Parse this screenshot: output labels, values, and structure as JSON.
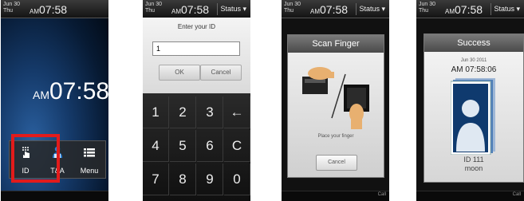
{
  "statusbar": {
    "date_line1": "Jun  30",
    "date_line2": "Thu",
    "ampm": "AM",
    "time": "07:58",
    "status_label": "Status ▾"
  },
  "bottom_bar": {
    "label": "Call"
  },
  "screen1": {
    "clock_ampm": "AM",
    "clock_time": "07:58",
    "buttons": [
      {
        "label": "ID",
        "icon": "hand-tap-icon"
      },
      {
        "label": "T&A",
        "icon": "user-icon"
      },
      {
        "label": "Menu",
        "icon": "list-menu-icon"
      }
    ],
    "highlight_color": "#e21b1b"
  },
  "screen2": {
    "title": "Enter your ID",
    "input_value": "1",
    "ok_label": "OK",
    "cancel_label": "Cancel",
    "keys": [
      "1",
      "2",
      "3",
      "←",
      "4",
      "5",
      "6",
      "C",
      "7",
      "8",
      "9",
      "0"
    ]
  },
  "screen3": {
    "title": "Scan Finger",
    "hint": "Place your finger",
    "cancel_label": "Cancel"
  },
  "screen4": {
    "title": "Success",
    "date": "Jun 30 2011",
    "time": "AM  07:58:06",
    "id": "ID  111",
    "name": "moon"
  }
}
